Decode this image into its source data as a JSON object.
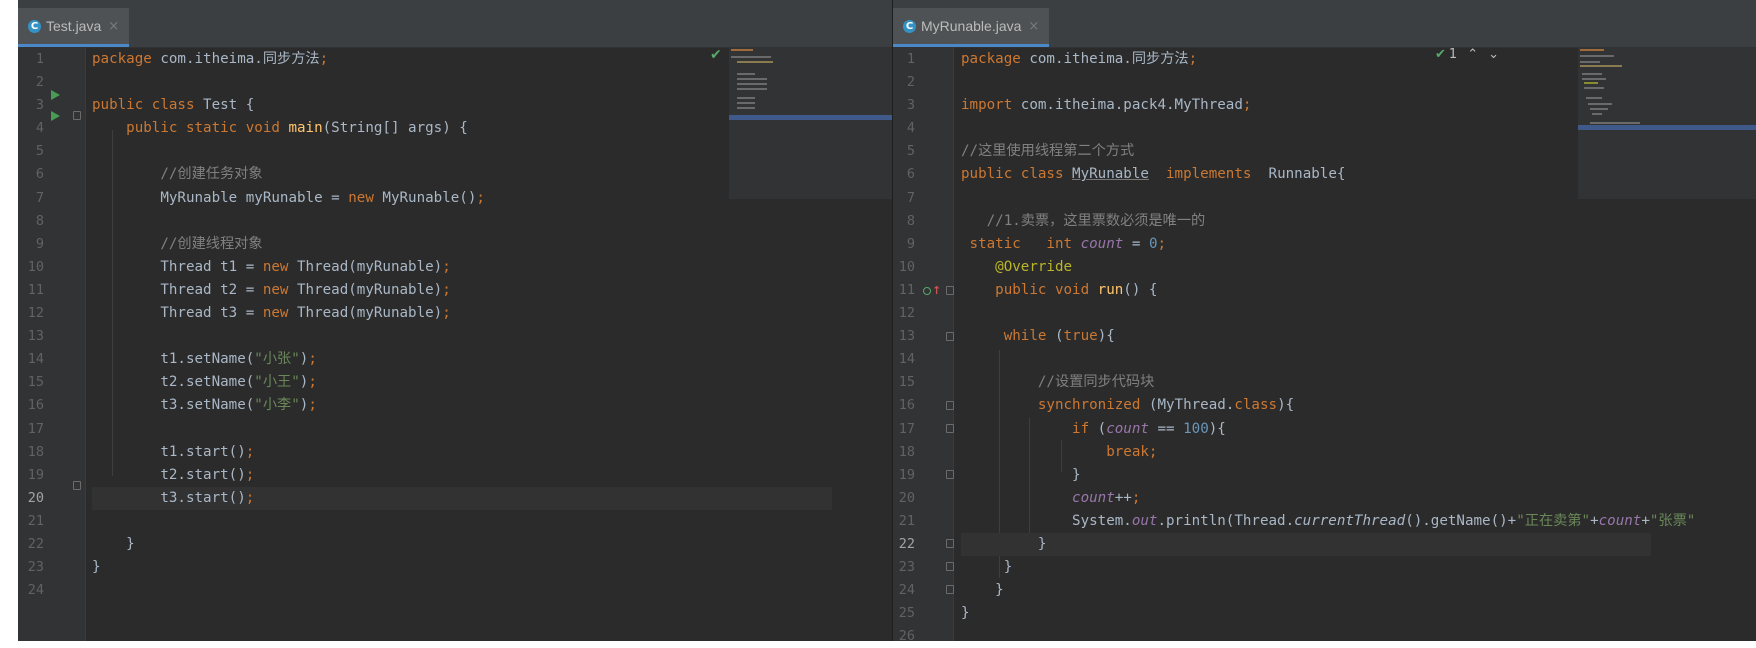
{
  "left_editor": {
    "tab_title": "Test.java",
    "tab_icon": "C",
    "close_glyph": "×",
    "status_glyph": "✔",
    "line_numbers": [
      "1",
      "2",
      "3",
      "4",
      "5",
      "6",
      "7",
      "8",
      "9",
      "10",
      "11",
      "12",
      "13",
      "14",
      "15",
      "16",
      "17",
      "18",
      "19",
      "20",
      "21",
      "22",
      "23",
      "24"
    ],
    "current_line": 20
  },
  "right_editor": {
    "tab_title": "MyRunable.java",
    "tab_icon": "C",
    "close_glyph": "×",
    "inspection_count": "1",
    "line_numbers": [
      "1",
      "2",
      "3",
      "4",
      "5",
      "6",
      "7",
      "8",
      "9",
      "10",
      "11",
      "12",
      "13",
      "14",
      "15",
      "16",
      "17",
      "18",
      "19",
      "20",
      "21",
      "22",
      "23",
      "24",
      "25",
      "26"
    ],
    "current_line": 22
  },
  "colors": {
    "editor_bg": "#2b2b2b",
    "keyword": "#cc7832",
    "string": "#6a8759",
    "number": "#6897bb",
    "comment": "#808080",
    "method_decl": "#ffc66d",
    "annotation": "#bbb529",
    "static_field": "#9876aa",
    "run_icon": "#499c54"
  },
  "icons": [
    "java-class-icon",
    "close-icon",
    "run-gutter-icon",
    "fold-icon",
    "check-icon",
    "override-gutter-icon",
    "chevron-up-icon",
    "chevron-down-icon"
  ]
}
